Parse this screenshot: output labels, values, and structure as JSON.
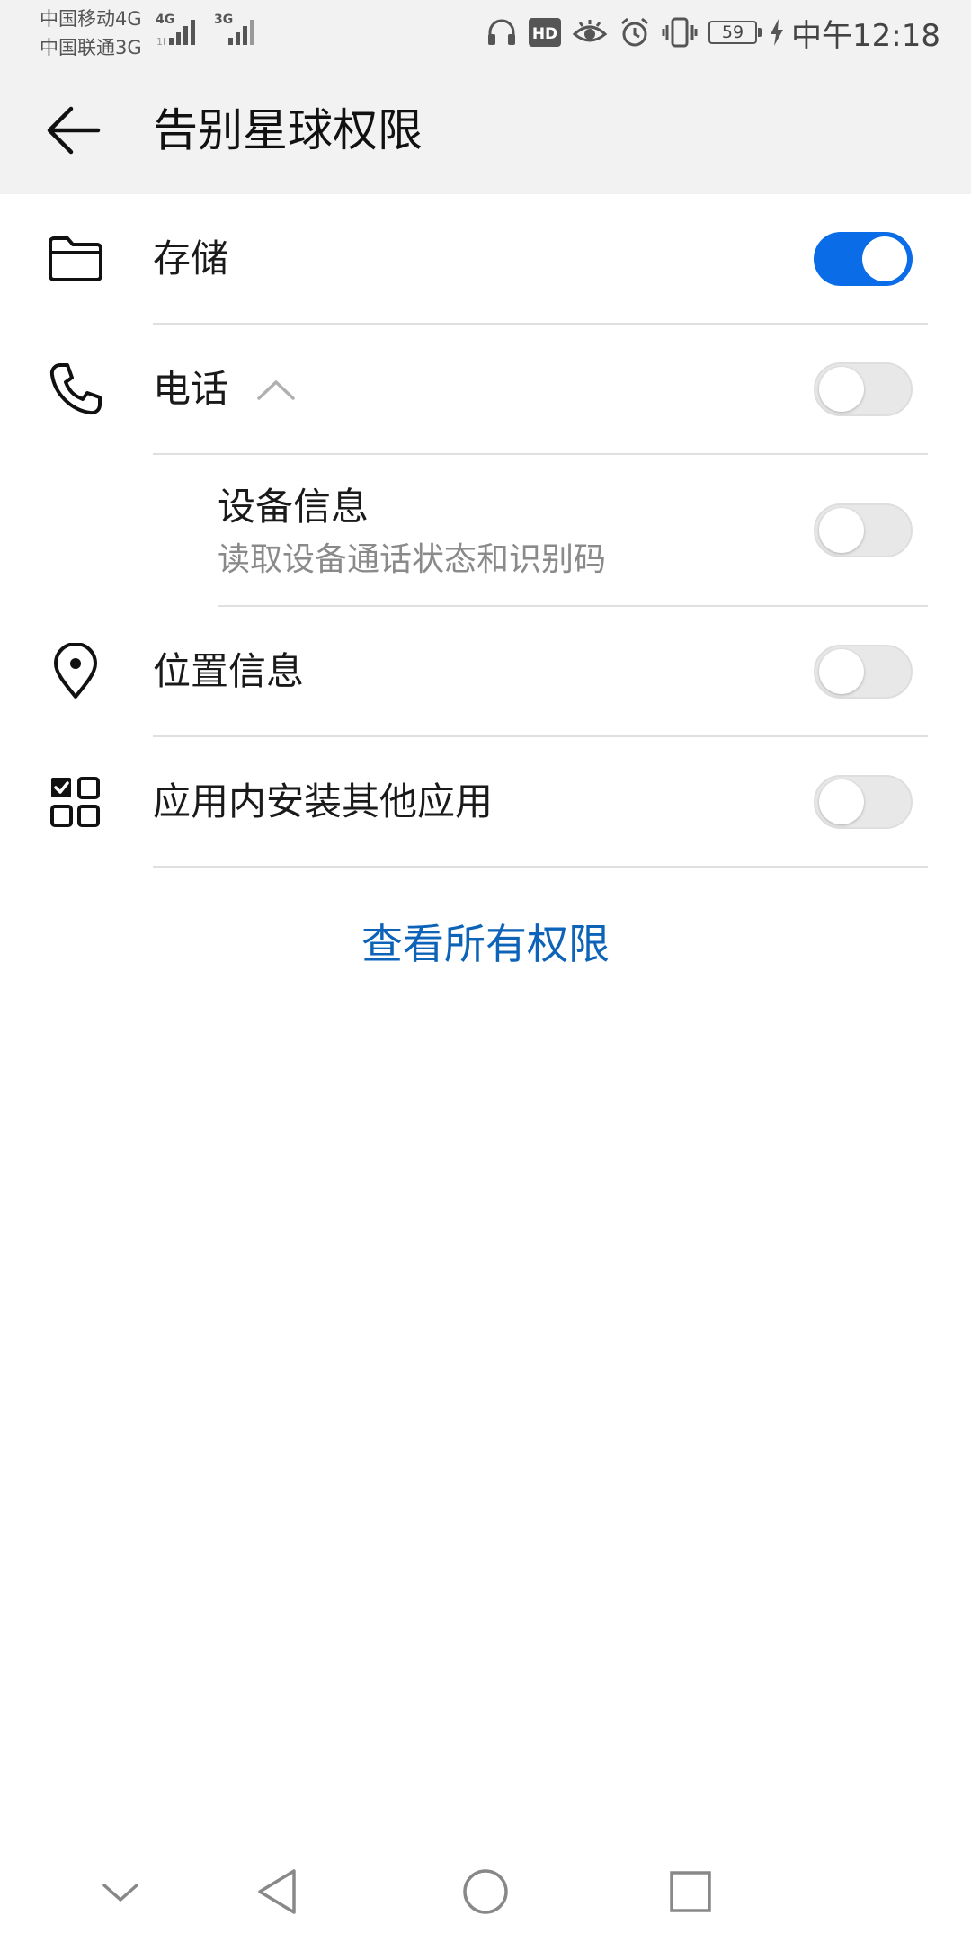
{
  "status_bar": {
    "carrier_1": "中国移动4G",
    "carrier_2": "中国联通3G",
    "sig_label_1": "4G",
    "sig_label_2": "3G",
    "hd_label": "HD",
    "battery_level": "59",
    "time": "中午12:18"
  },
  "header": {
    "title": "告别星球权限"
  },
  "permissions": {
    "storage": {
      "label": "存储",
      "enabled": true
    },
    "phone": {
      "label": "电话",
      "enabled": false,
      "expanded": true
    },
    "device_info": {
      "title": "设备信息",
      "description": "读取设备通话状态和识别码",
      "enabled": false
    },
    "location": {
      "label": "位置信息",
      "enabled": false
    },
    "install_apps": {
      "label": "应用内安装其他应用",
      "enabled": false
    }
  },
  "links": {
    "view_all": "查看所有权限"
  },
  "colors": {
    "accent": "#0a6ce6",
    "link": "#0d63b8",
    "bar_background": "#f2f2f2",
    "divider": "#e0e0e0"
  },
  "icons": {
    "back": "arrow-left-icon",
    "storage": "folder-icon",
    "phone": "phone-icon",
    "location": "location-pin-icon",
    "install_apps": "app-grid-icon"
  }
}
